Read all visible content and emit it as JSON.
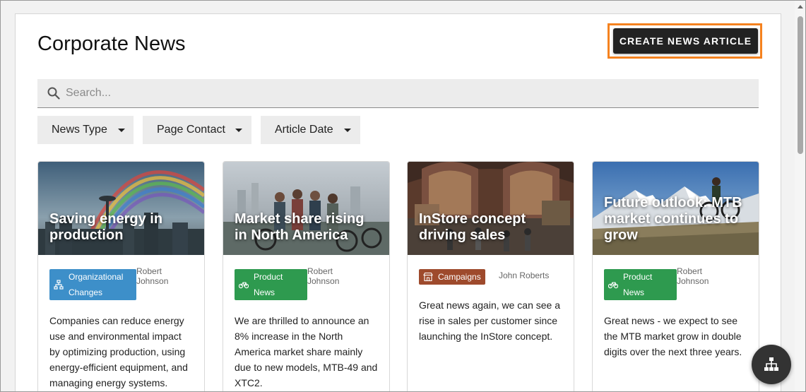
{
  "header": {
    "title": "Corporate News",
    "create_label": "CREATE NEWS ARTICLE"
  },
  "search": {
    "placeholder": "Search..."
  },
  "filters": [
    {
      "label": "News Type"
    },
    {
      "label": "Page Contact"
    },
    {
      "label": "Article Date"
    }
  ],
  "cards": [
    {
      "title": "Saving energy in production",
      "tag": "Organizational Changes",
      "tag_color": "#3d8fc9",
      "tag_icon": "org-chart-icon",
      "author": "Robert Johnson",
      "body": "Companies can reduce energy use and environmental impact by optimizing production, using energy-efficient equipment, and managing energy systems."
    },
    {
      "title": "Market share rising in North America",
      "tag": "Product News",
      "tag_color": "#2e9a4f",
      "tag_icon": "bicycle-icon",
      "author": "Robert Johnson",
      "body": "We are thrilled to announce an 8% increase in the North America market share mainly due to new models, MTB-49 and XTC2."
    },
    {
      "title": "InStore concept driving sales",
      "tag": "Campaigns",
      "tag_color": "#9e4a2c",
      "tag_icon": "store-icon",
      "author": "John Roberts",
      "body": "Great news again, we can see a rise in sales per customer since launching the InStore concept."
    },
    {
      "title": "Future outlook: MTB market continues to grow",
      "tag": "Product News",
      "tag_color": "#2e9a4f",
      "tag_icon": "bicycle-icon",
      "author": "Robert Johnson",
      "body": "Great news - we expect to see the MTB market grow in double digits over the next three years."
    }
  ],
  "fab": {
    "icon": "sitemap-icon"
  },
  "colors": {
    "accent_outline": "#f5821f",
    "button_dark": "#222222"
  }
}
